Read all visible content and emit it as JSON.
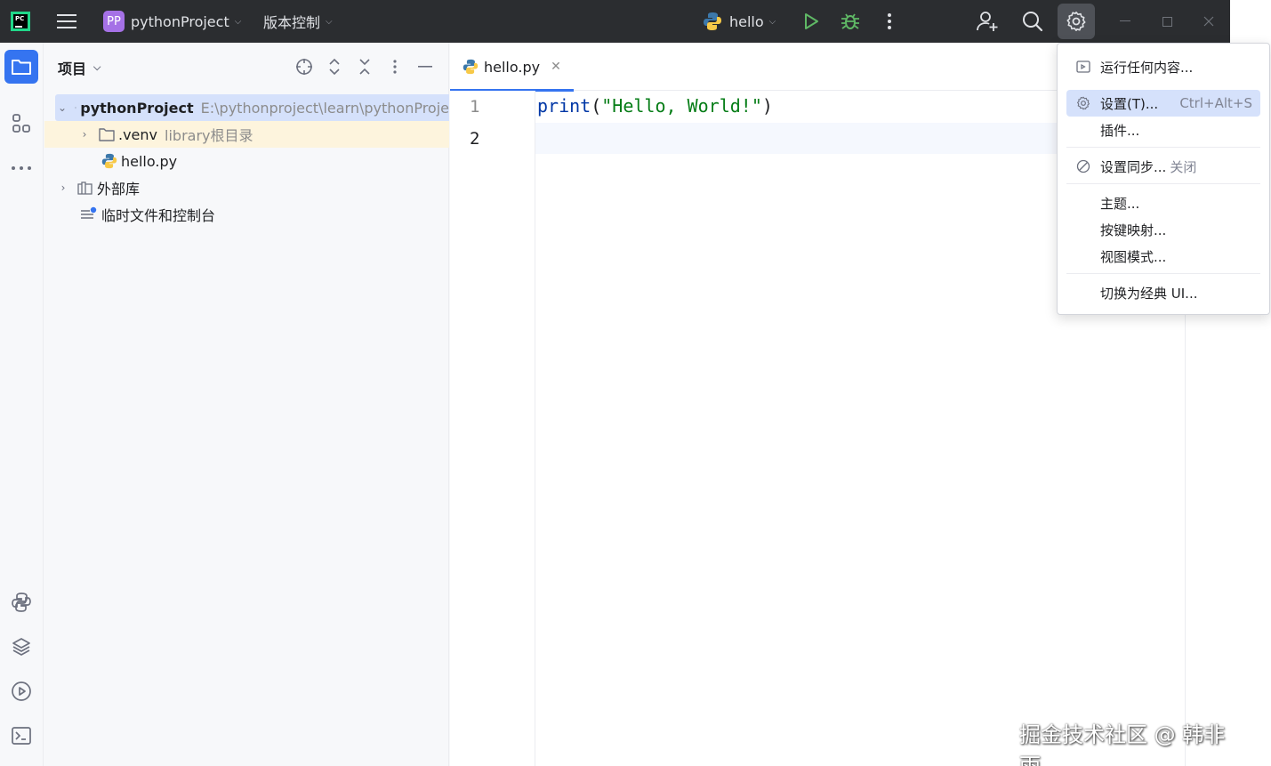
{
  "titlebar": {
    "logo_text": "PC",
    "project_badge": "PP",
    "project_name": "pythonProject",
    "vcs_label": "版本控制",
    "run_config": "hello"
  },
  "colors": {
    "accent": "#3574f0",
    "titlebar_bg": "#2b2d30",
    "selected_row": "#d5e1fb",
    "excluded_row": "#fdf4dd",
    "run_green": "#499c54",
    "project_badge": "#a571e6"
  },
  "toolstrip": {
    "items": [
      "folder-icon",
      "structure-icon",
      "more-icon",
      "python-console-icon",
      "python-packages-icon",
      "services-icon",
      "terminal-icon"
    ]
  },
  "project_panel": {
    "title": "项目",
    "tree": {
      "root_name": "pythonProject",
      "root_path": "E:\\pythonproject\\learn\\pythonProje",
      "venv_name": ".venv",
      "venv_hint": "library根目录",
      "file_name": "hello.py",
      "external_libs": "外部库",
      "scratches": "临时文件和控制台"
    }
  },
  "editor": {
    "tab_label": "hello.py",
    "line_numbers": [
      "1",
      "2"
    ],
    "code": {
      "fn": "print",
      "open": "(",
      "string": "\"Hello, World!\"",
      "close": ")"
    }
  },
  "settings_menu": {
    "run_anything": "运行任何内容...",
    "settings": "设置(T)...",
    "settings_shortcut": "Ctrl+Alt+S",
    "plugins": "插件...",
    "settings_sync": "设置同步...",
    "settings_sync_state": "关闭",
    "theme": "主题...",
    "keymap": "按键映射...",
    "view_mode": "视图模式...",
    "classic_ui": "切换为经典 UI..."
  },
  "watermark": "掘金技术社区 @ 韩非雨"
}
